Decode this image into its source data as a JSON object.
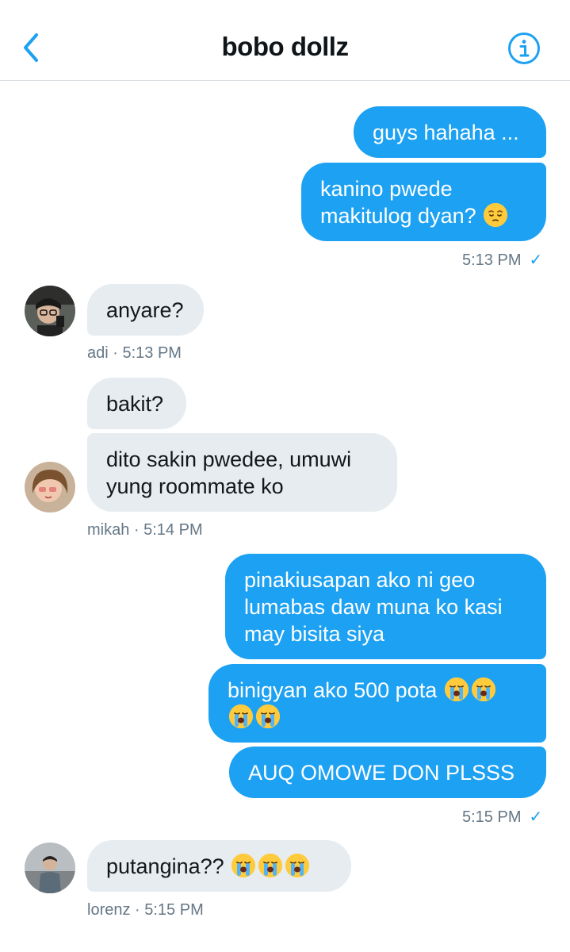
{
  "header": {
    "title": "bobo dollz",
    "back_icon": "chevron-left-icon",
    "info_icon": "info-circle-icon"
  },
  "colors": {
    "accent": "#1da1f2",
    "incoming_bubble": "#e6ecf0",
    "meta_text": "#657786",
    "divider": "#d8dde2"
  },
  "messages": [
    {
      "sender": "me",
      "text": "guys hahaha ..."
    },
    {
      "sender": "me",
      "text": "kanino pwede\nmakitulog dyan?",
      "emoji": [
        "pensive-face-emoji"
      ]
    },
    {
      "sender": "adi",
      "text": "anyare?"
    },
    {
      "sender": "mikah",
      "text": "bakit?"
    },
    {
      "sender": "mikah",
      "text": "dito sakin pwedee, umuwi\nyung roommate ko"
    },
    {
      "sender": "me",
      "text": "pinakiusapan ako ni geo\nlumabas daw muna ko kasi\nmay bisita siya"
    },
    {
      "sender": "me",
      "text": "binigyan ako 500 pota",
      "emoji": [
        "loudly-crying-face-emoji",
        "loudly-crying-face-emoji",
        "loudly-crying-face-emoji",
        "loudly-crying-face-emoji"
      ]
    },
    {
      "sender": "me",
      "text": "AUQ OMOWE DON PLSSS"
    },
    {
      "sender": "lorenz",
      "text": "putangina??",
      "emoji": [
        "loudly-crying-face-emoji",
        "loudly-crying-face-emoji",
        "loudly-crying-face-emoji"
      ]
    }
  ],
  "meta": {
    "sent_1": "5:13 PM",
    "adi": "adi · 5:13 PM",
    "mikah": "mikah · 5:14 PM",
    "sent_2": "5:15 PM",
    "lorenz": "lorenz · 5:15 PM",
    "read_icon": "checkmark-icon"
  }
}
